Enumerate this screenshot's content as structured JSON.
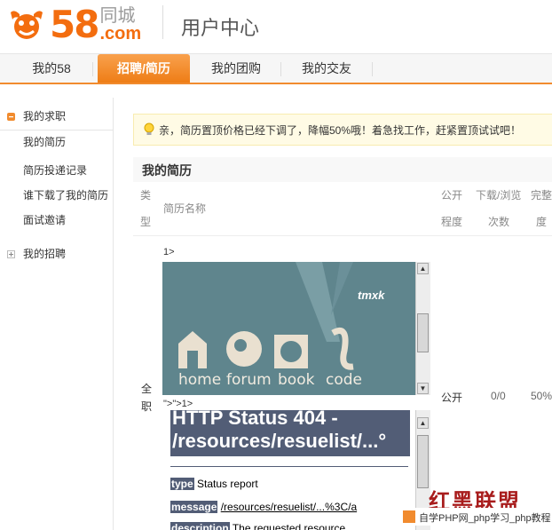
{
  "header": {
    "logo_58": "58",
    "logo_cn": "同城",
    "logo_com": ".com",
    "title": "用户中心"
  },
  "tabs": [
    {
      "label": "我的58"
    },
    {
      "label": "招聘/简历"
    },
    {
      "label": "我的团购"
    },
    {
      "label": "我的交友"
    }
  ],
  "sidebar": {
    "group1": "我的求职",
    "items": [
      "我的简历",
      "简历投递记录",
      "谁下载了我的简历",
      "面试邀请"
    ],
    "group2": "我的招聘"
  },
  "notice": "亲，简历置顶价格已经下调了，降幅50%哦！着急找工作，赶紧置顶试试吧！",
  "resume": {
    "title": "我的简历",
    "headers": {
      "type_1": "类",
      "type_2": "型",
      "name": "简历名称",
      "public_1": "公开",
      "public_2": "程度",
      "dl_1": "下载/浏览",
      "dl_2": "次数",
      "comp_1": "完整",
      "comp_2": "度"
    },
    "row": {
      "type_1": "全",
      "type_2": "职",
      "prefix": "1>",
      "middle": "\">\">1>",
      "public": "公开",
      "downloads": "0/0",
      "completeness": "50%"
    }
  },
  "embedded_image": {
    "labels": [
      "home",
      "forum",
      "book",
      "code"
    ],
    "tag": "tmxk"
  },
  "error_page": {
    "heading_1": "HTTP Status 404 -",
    "heading_2": "/resources/resuelist/...°",
    "type_key": "type",
    "type_value": "Status report",
    "message_key": "message",
    "message_value": "/resources/resuelist/...%3C/a",
    "desc_key": "description",
    "desc_value": "The requested resource"
  },
  "watermark": {
    "big": "红黑联盟",
    "small": "自学PHP网_php学习_php教程"
  },
  "colors": {
    "brand_orange": "#f36d0f",
    "tab_active": "#ee7d16",
    "notice_bg": "#fffbe5",
    "error_blue": "#525d76",
    "embed_teal": "#5f858d"
  }
}
